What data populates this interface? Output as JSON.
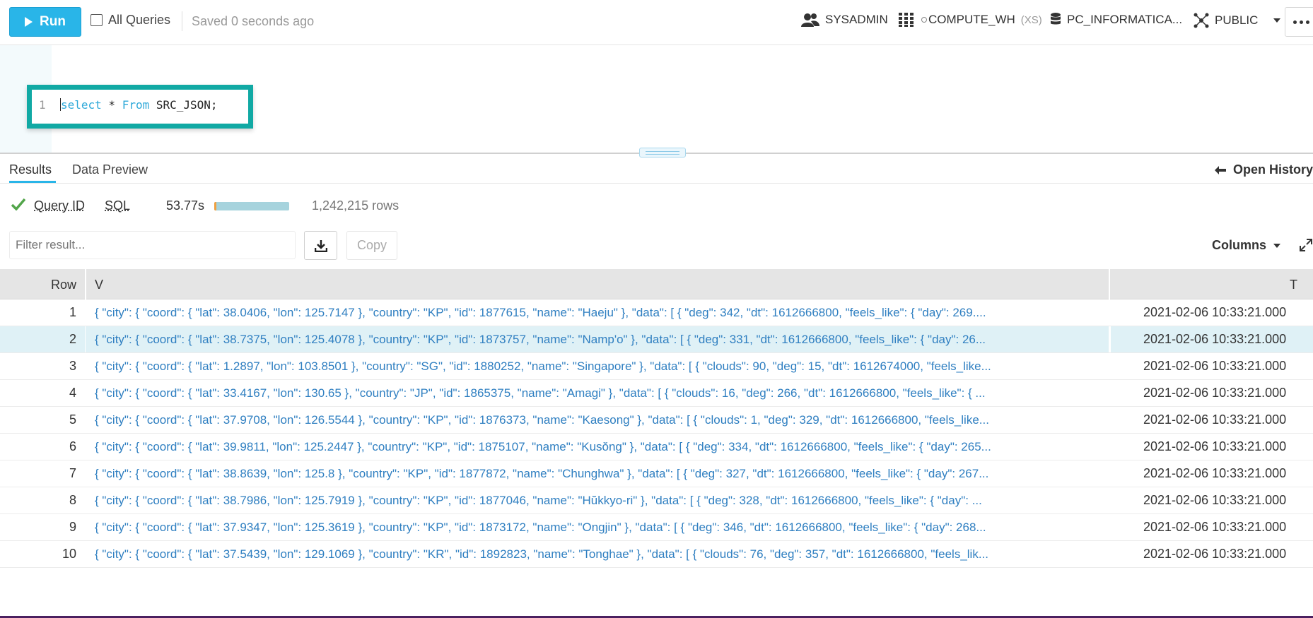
{
  "toolbar": {
    "run_label": "Run",
    "all_queries_label": "All Queries",
    "saved_status": "Saved 0 seconds ago",
    "role": "SYSADMIN",
    "warehouse": "COMPUTE_WH",
    "warehouse_size": "(XS)",
    "database": "PC_INFORMATICA...",
    "schema": "PUBLIC"
  },
  "editor": {
    "line_number": "1",
    "kw_select": "select",
    "star": " * ",
    "kw_from": "From",
    "table_ref": " SRC_JSON;"
  },
  "results_tabs": {
    "results": "Results",
    "data_preview": "Data Preview",
    "open_history": "Open History"
  },
  "query_info": {
    "query_id_label": "Query ID",
    "sql_label": "SQL",
    "duration": "53.77s",
    "progress_fraction": 1.0,
    "rows": "1,242,215 rows"
  },
  "filter": {
    "placeholder": "Filter result...",
    "copy_label": "Copy",
    "columns_label": "Columns"
  },
  "table": {
    "headers": {
      "row": "Row",
      "v": "V",
      "t": "T"
    },
    "rows": [
      {
        "num": "1",
        "v": "{ \"city\": { \"coord\": { \"lat\": 38.0406, \"lon\": 125.7147 }, \"country\": \"KP\", \"id\": 1877615, \"name\": \"Haeju\" }, \"data\": [ { \"deg\": 342, \"dt\": 1612666800, \"feels_like\": { \"day\": 269....",
        "t": "2021-02-06 10:33:21.000"
      },
      {
        "num": "2",
        "v": "{ \"city\": { \"coord\": { \"lat\": 38.7375, \"lon\": 125.4078 }, \"country\": \"KP\", \"id\": 1873757, \"name\": \"Namp'o\" }, \"data\": [ { \"deg\": 331, \"dt\": 1612666800, \"feels_like\": { \"day\": 26...",
        "t": "2021-02-06 10:33:21.000"
      },
      {
        "num": "3",
        "v": "{ \"city\": { \"coord\": { \"lat\": 1.2897, \"lon\": 103.8501 }, \"country\": \"SG\", \"id\": 1880252, \"name\": \"Singapore\" }, \"data\": [ { \"clouds\": 90, \"deg\": 15, \"dt\": 1612674000, \"feels_like...",
        "t": "2021-02-06 10:33:21.000"
      },
      {
        "num": "4",
        "v": "{ \"city\": { \"coord\": { \"lat\": 33.4167, \"lon\": 130.65 }, \"country\": \"JP\", \"id\": 1865375, \"name\": \"Amagi\" }, \"data\": [ { \"clouds\": 16, \"deg\": 266, \"dt\": 1612666800, \"feels_like\": { ...",
        "t": "2021-02-06 10:33:21.000"
      },
      {
        "num": "5",
        "v": "{ \"city\": { \"coord\": { \"lat\": 37.9708, \"lon\": 126.5544 }, \"country\": \"KP\", \"id\": 1876373, \"name\": \"Kaesong\" }, \"data\": [ { \"clouds\": 1, \"deg\": 329, \"dt\": 1612666800, \"feels_like...",
        "t": "2021-02-06 10:33:21.000"
      },
      {
        "num": "6",
        "v": "{ \"city\": { \"coord\": { \"lat\": 39.9811, \"lon\": 125.2447 }, \"country\": \"KP\", \"id\": 1875107, \"name\": \"Kusŏng\" }, \"data\": [ { \"deg\": 334, \"dt\": 1612666800, \"feels_like\": { \"day\": 265...",
        "t": "2021-02-06 10:33:21.000"
      },
      {
        "num": "7",
        "v": "{ \"city\": { \"coord\": { \"lat\": 38.8639, \"lon\": 125.8 }, \"country\": \"KP\", \"id\": 1877872, \"name\": \"Chunghwa\" }, \"data\": [ { \"deg\": 327, \"dt\": 1612666800, \"feels_like\": { \"day\": 267...",
        "t": "2021-02-06 10:33:21.000"
      },
      {
        "num": "8",
        "v": "{ \"city\": { \"coord\": { \"lat\": 38.7986, \"lon\": 125.7919 }, \"country\": \"KP\", \"id\": 1877046, \"name\": \"Hŭkkyo-ri\" }, \"data\": [ { \"deg\": 328, \"dt\": 1612666800, \"feels_like\": { \"day\": ...",
        "t": "2021-02-06 10:33:21.000"
      },
      {
        "num": "9",
        "v": "{ \"city\": { \"coord\": { \"lat\": 37.9347, \"lon\": 125.3619 }, \"country\": \"KP\", \"id\": 1873172, \"name\": \"Ongjin\" }, \"data\": [ { \"deg\": 346, \"dt\": 1612666800, \"feels_like\": { \"day\": 268...",
        "t": "2021-02-06 10:33:21.000"
      },
      {
        "num": "10",
        "v": "{ \"city\": { \"coord\": { \"lat\": 37.5439, \"lon\": 129.1069 }, \"country\": \"KR\", \"id\": 1892823, \"name\": \"Tonghae\" }, \"data\": [ { \"clouds\": 76, \"deg\": 357, \"dt\": 1612666800, \"feels_lik...",
        "t": "2021-02-06 10:33:21.000"
      }
    ]
  },
  "icons": {
    "run": "play-icon",
    "role": "users-icon",
    "warehouse": "grid-icon",
    "database": "database-icon",
    "schema": "schema-icon",
    "more": "ellipsis-icon",
    "success": "check-icon",
    "history": "arrow-left-icon",
    "download": "download-icon",
    "expand": "expand-icon"
  },
  "colors": {
    "accent": "#29b5e8",
    "highlight_box": "#11a9a4",
    "json_text": "#2f7fc1",
    "success": "#52a54a",
    "selected_row": "#dff1f6"
  }
}
